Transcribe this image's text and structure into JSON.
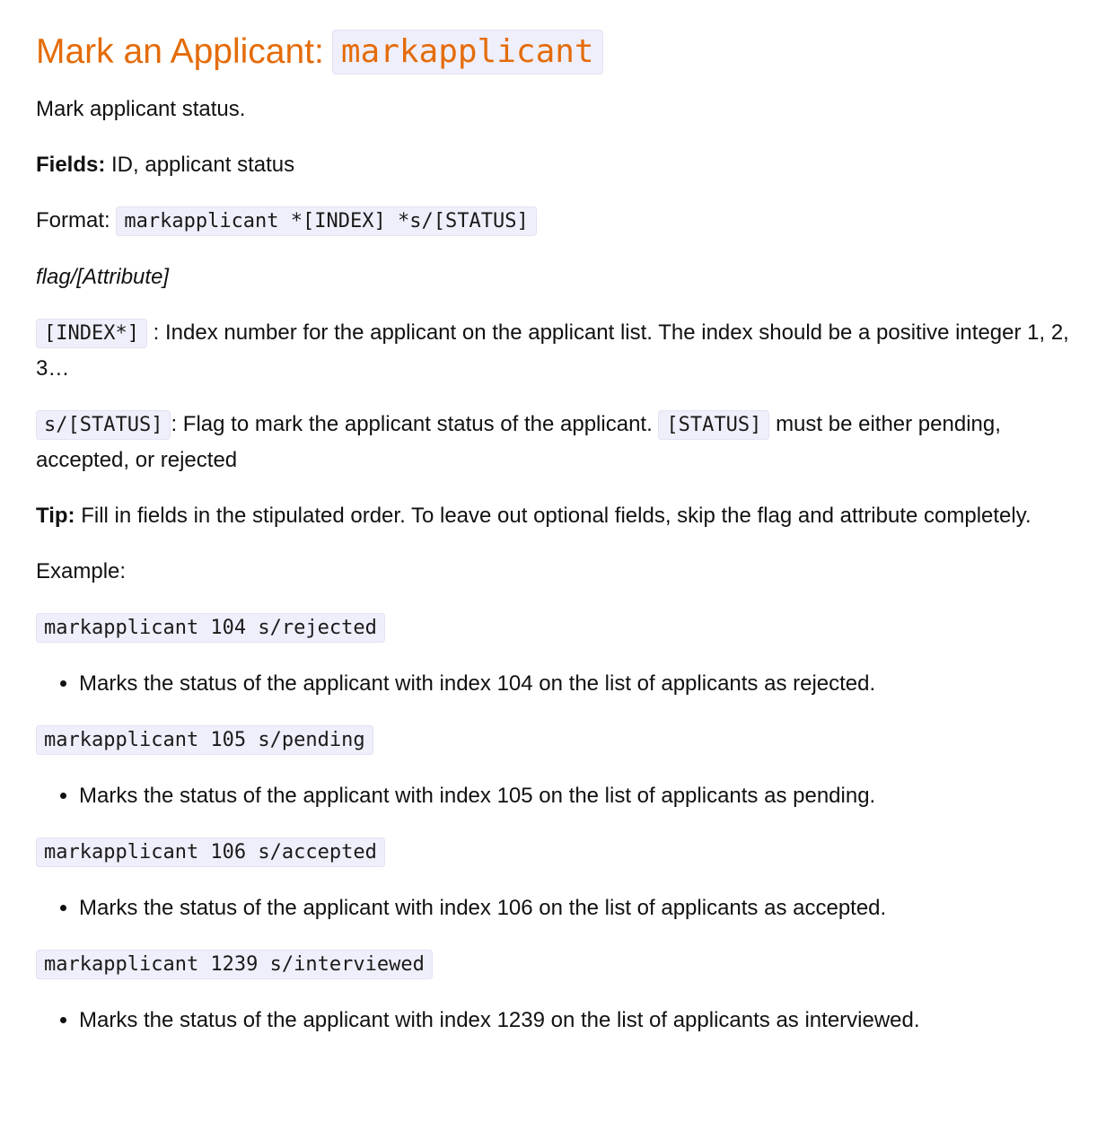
{
  "heading": {
    "text": "Mark an Applicant:",
    "code": "markapplicant"
  },
  "description": "Mark applicant status.",
  "fields": {
    "label": "Fields:",
    "value": "ID, applicant status"
  },
  "format": {
    "label": "Format:",
    "code": "markapplicant *[INDEX] *s/[STATUS]"
  },
  "flag_note": "flag/[Attribute]",
  "index_param": {
    "code": "[INDEX*]",
    "text": ": Index number for the applicant on the applicant list. The index should be a positive integer 1, 2, 3…"
  },
  "status_param": {
    "code": "s/[STATUS]",
    "text_before": ": Flag to mark the applicant status of the applicant.",
    "code2": "[STATUS]",
    "text_after": "must be either pending, accepted, or rejected"
  },
  "tip": {
    "label": "Tip:",
    "text": "Fill in fields in the stipulated order. To leave out optional fields, skip the flag and attribute completely."
  },
  "example_label": "Example:",
  "examples": [
    {
      "code": "markapplicant 104 s/rejected",
      "description": "Marks the status of the applicant with index 104 on the list of applicants as rejected."
    },
    {
      "code": "markapplicant 105 s/pending",
      "description": "Marks the status of the applicant with index 105 on the list of applicants as pending."
    },
    {
      "code": "markapplicant 106 s/accepted",
      "description": "Marks the status of the applicant with index 106 on the list of applicants as accepted."
    },
    {
      "code": "markapplicant 1239 s/interviewed",
      "description": "Marks the status of the applicant with index 1239 on the list of applicants as interviewed."
    }
  ],
  "colors": {
    "heading": "#e46c0a",
    "code_background": "#efeffb",
    "text": "#111111"
  }
}
